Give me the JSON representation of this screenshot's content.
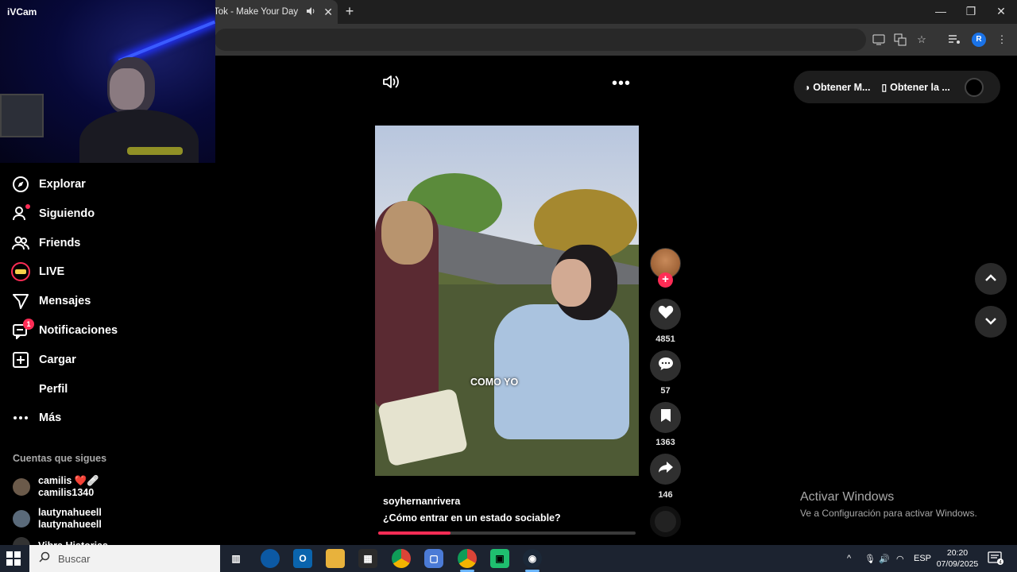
{
  "browser": {
    "tab_title": "Tok - Make Your Day",
    "tab_audio_icon": "speaker-icon",
    "tab_close": "✕",
    "new_tab": "+",
    "profile_initial": "R"
  },
  "webcam": {
    "title": "iVCam"
  },
  "nav": {
    "items": [
      {
        "label": "Explorar",
        "icon": "compass-icon"
      },
      {
        "label": "Siguiendo",
        "icon": "user-follow-icon"
      },
      {
        "label": "Friends",
        "icon": "friends-icon"
      },
      {
        "label": "LIVE",
        "icon": "live-icon"
      },
      {
        "label": "Mensajes",
        "icon": "send-icon"
      },
      {
        "label": "Notificaciones",
        "icon": "bell-message-icon",
        "badge": "1"
      },
      {
        "label": "Cargar",
        "icon": "upload-plus-icon"
      },
      {
        "label": "Perfil",
        "icon": "profile-icon"
      },
      {
        "label": "Más",
        "icon": "more-horizontal-icon"
      }
    ],
    "following_title": "Cuentas que sigues",
    "accounts": [
      {
        "name": "camilis ❤️🩹",
        "handle": "camilis1340"
      },
      {
        "name": "lautynahueell",
        "handle": "lautynahueell"
      },
      {
        "name": "Vibra Historias",
        "handle": ""
      }
    ]
  },
  "video": {
    "caption_overlay": "COMO YO",
    "username": "soyhernanrivera",
    "description": "¿Cómo entrar en un estado sociable?",
    "progress": 0.28
  },
  "actions": {
    "likes": "4851",
    "comments": "57",
    "saves": "1363",
    "shares": "146"
  },
  "top_pill": {
    "btn1": "Obtener M...",
    "btn2": "Obtener la ..."
  },
  "watermark": {
    "line1": "Activar Windows",
    "line2": "Ve a Configuración para activar Windows."
  },
  "taskbar": {
    "search_placeholder": "Buscar",
    "lang": "ESP",
    "time": "20:20",
    "date": "07/09/2025",
    "notif_count": "4"
  },
  "colors": {
    "accent": "#fe2c55",
    "taskbar": "#1c2330"
  }
}
